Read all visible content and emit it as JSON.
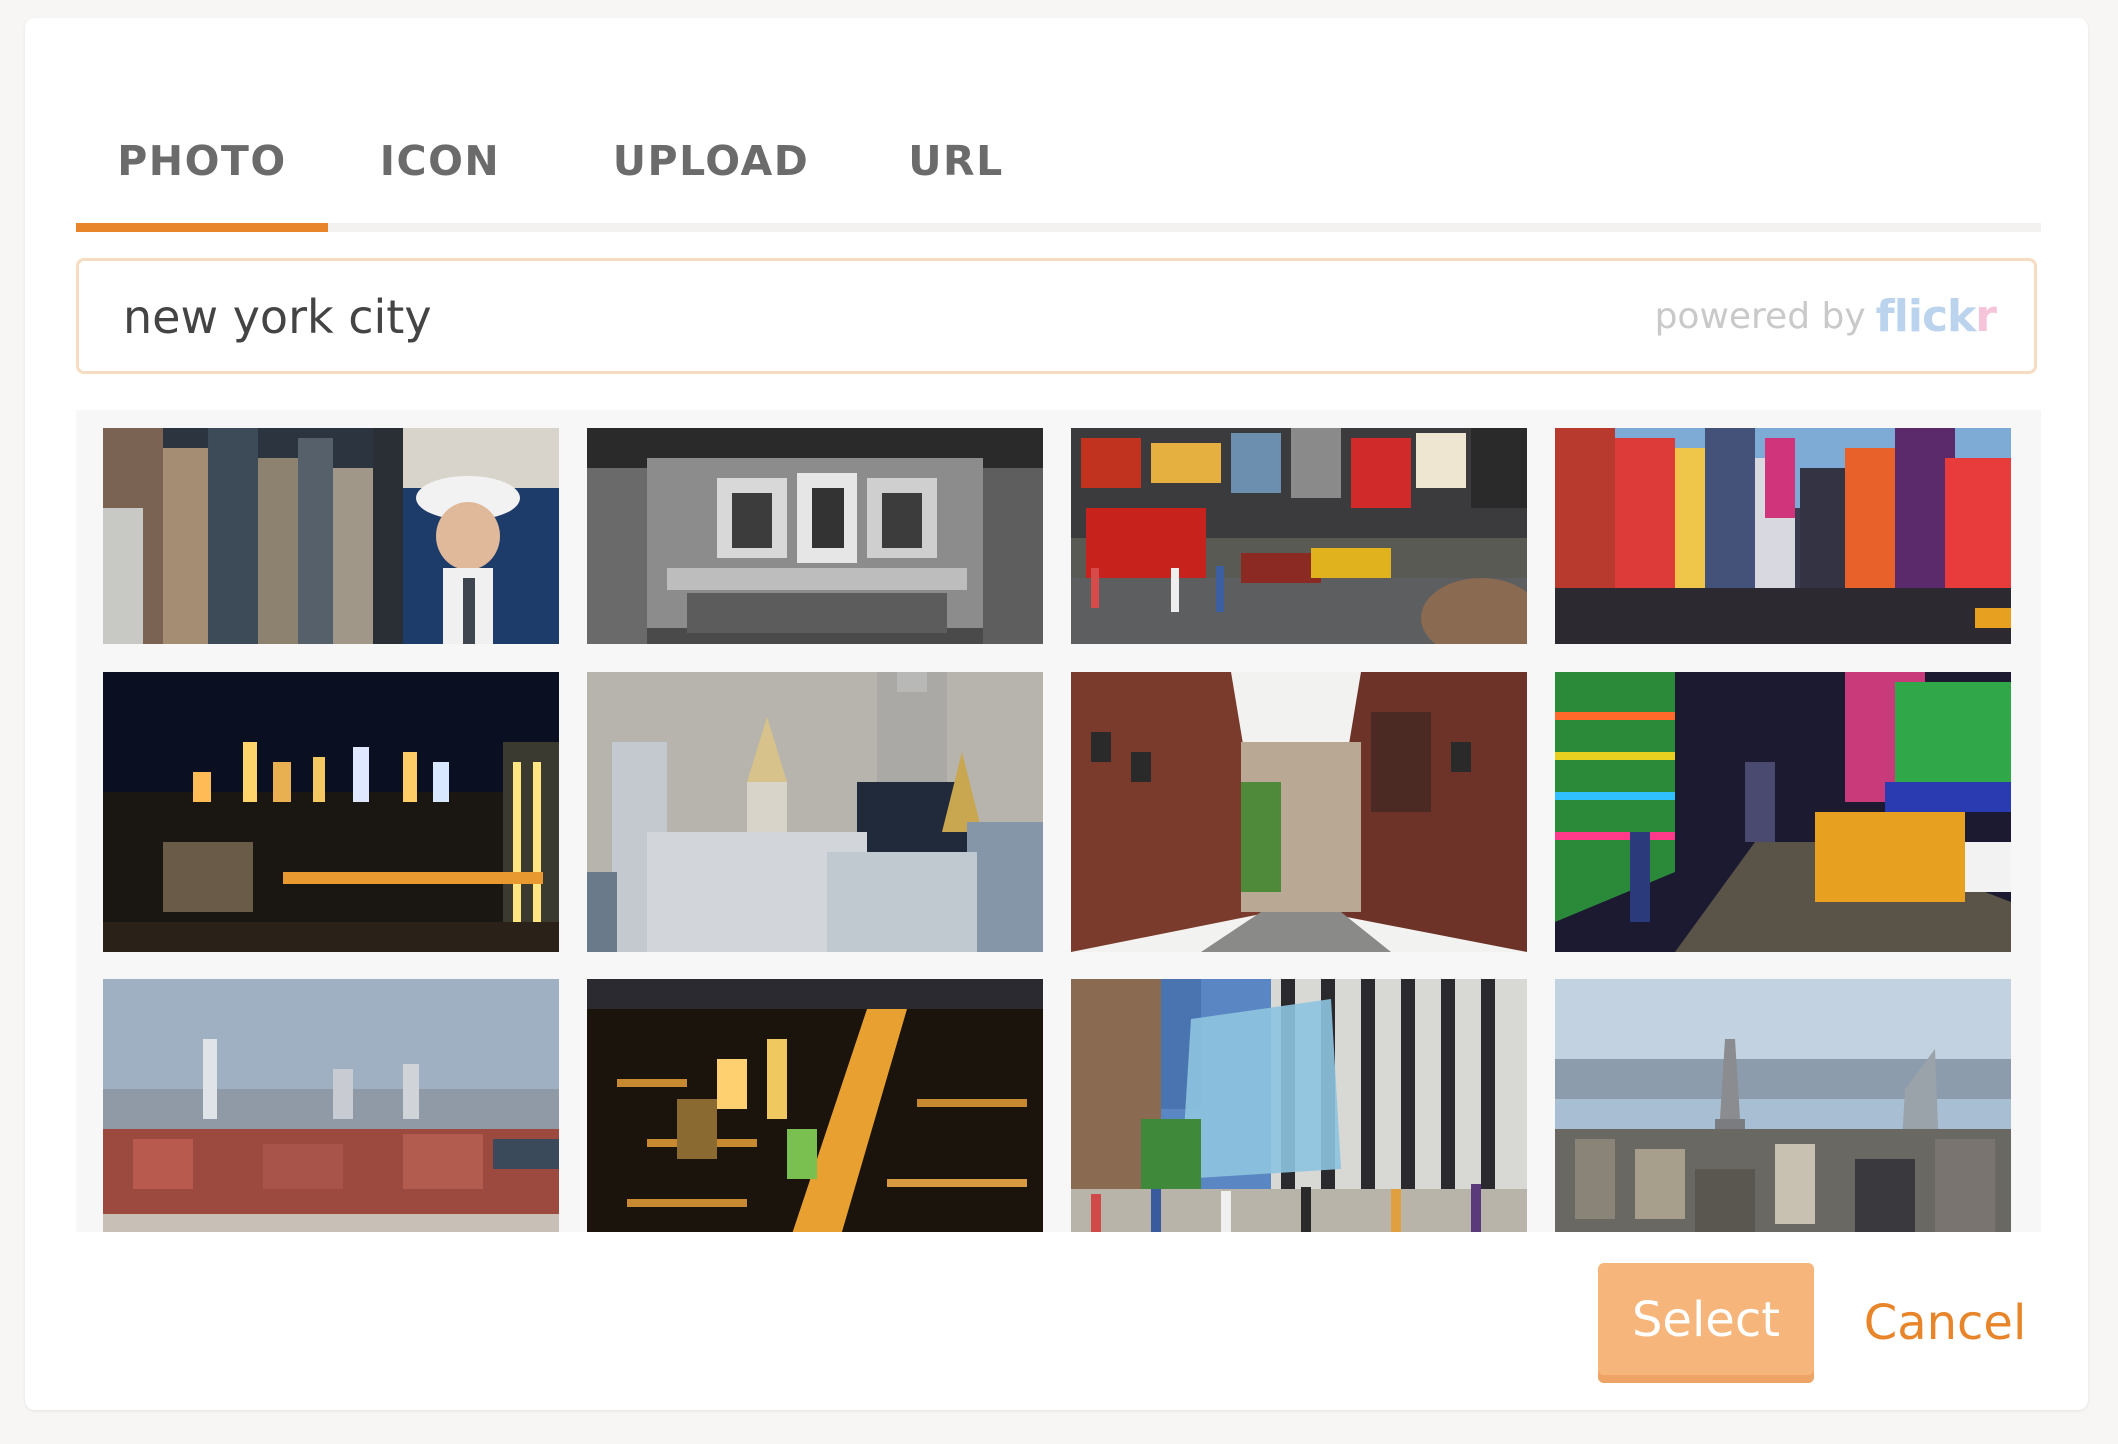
{
  "tabs": [
    {
      "label": "PHOTO",
      "active": true
    },
    {
      "label": "ICON",
      "active": false
    },
    {
      "label": "UPLOAD",
      "active": false
    },
    {
      "label": "URL",
      "active": false
    }
  ],
  "search": {
    "value": "new york city",
    "powered_by": "powered by",
    "provider_logo_part1": "flick",
    "provider_logo_part2": "r"
  },
  "colors": {
    "accent": "#e8852a",
    "select_button": "#f6b57a",
    "search_border": "#f6dcc0"
  },
  "results": [
    {
      "subject": "street canyon with portrait mural"
    },
    {
      "subject": "ornate facade black and white"
    },
    {
      "subject": "times square yellow cabs"
    },
    {
      "subject": "times square billboards"
    },
    {
      "subject": "skyline at night"
    },
    {
      "subject": "empire state building and towers"
    },
    {
      "subject": "red brick street"
    },
    {
      "subject": "neon street at night"
    },
    {
      "subject": "skyline across river"
    },
    {
      "subject": "aerial city lights"
    },
    {
      "subject": "glass cube store plaza"
    },
    {
      "subject": "aerial skyline daytime"
    }
  ],
  "actions": {
    "select_label": "Select",
    "cancel_label": "Cancel"
  }
}
